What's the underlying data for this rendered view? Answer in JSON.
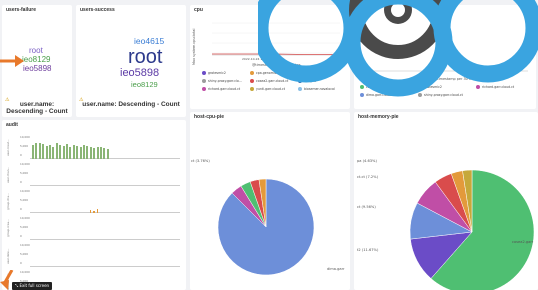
{
  "panels": {
    "users_failure": {
      "title": "users-failure",
      "words": [
        "root",
        "ieo8129",
        "ieo5898"
      ],
      "sort_label": "user.name: Descending - Count"
    },
    "users_success": {
      "title": "users-success",
      "words": [
        "ieo4615",
        "root",
        "ieo5898",
        "ieo8129"
      ],
      "sort_label": "user.name: Descending - Count"
    },
    "cpu": {
      "title": "cpu",
      "ylabel": "Max system.cpu.total",
      "xlabel": "@timestamp per 30 minutes",
      "xtick": "2022-10-24 18:00",
      "legend": [
        "grotesmic2",
        "cpa.genomic.garr.cloud.ct",
        "dima.garr.cloud.ct",
        "shiny-proxy.garr.clo...",
        "cosea2.garr.cloud.ct",
        "epagou",
        "richard.garr.cloud.ct",
        "yunti.garr.cloud.ct",
        "biosemer.novalocal"
      ],
      "legend_colors": [
        "#6b4cc7",
        "#e39a3b",
        "#6d8fd9",
        "#9c9c9c",
        "#d94c4c",
        "#2f6db3",
        "#c04ea6",
        "#c6a83a",
        "#8bc0e6"
      ]
    },
    "memory": {
      "xlabel": "@timestamp per 30 minutes",
      "legend": [
        "cosea2.garr.cloud.ct",
        "protesmic2",
        "richard.garr.cloud.ct",
        "dima.garr.cloud.ct",
        "shiny-proxy.garr.cloud.ct"
      ],
      "legend_colors": [
        "#4fbf72",
        "#6b4cc7",
        "#c04ea6",
        "#6d8fd9",
        "#9c9c9c"
      ]
    },
    "audit": {
      "title": "audit",
      "rows": [
        "user.creat...",
        "user.chan...",
        "group.cha...",
        "group.crea...",
        "user.dele...",
        "user.rename"
      ],
      "ticks": [
        "10,000",
        "5,000",
        "0"
      ]
    },
    "host_cpu_pie": {
      "title": "host-cpu-pie",
      "labels": [
        "ct (3.76%)",
        "dima.garr"
      ]
    },
    "host_memory_pie": {
      "title": "host-memory-pie",
      "labels": [
        "pa (4.63%)",
        "ct.ct (7.2%)",
        "ct (9.56%)",
        "t2 (11.67%)",
        "cosea2.garr"
      ]
    }
  },
  "chart_data": [
    {
      "type": "pie",
      "title": "host-cpu-pie",
      "labels": [
        "dima.garr.cloud.ct",
        "other",
        "other",
        "other",
        "other"
      ],
      "values": [
        87.5,
        3.76,
        3.4,
        3.0,
        2.34
      ],
      "colors": [
        "#6d8fd9",
        "#c04ea6",
        "#4fbf72",
        "#d94c4c",
        "#e39a3b"
      ]
    },
    {
      "type": "pie",
      "title": "host-memory-pie",
      "labels": [
        "cosea2.garr.cloud.ct",
        "t2",
        "ct",
        "ct.ct",
        "pa",
        "other",
        "other"
      ],
      "values": [
        61.5,
        11.67,
        9.56,
        7.2,
        4.63,
        3.0,
        2.44
      ],
      "colors": [
        "#4fbf72",
        "#6b4cc7",
        "#6d8fd9",
        "#c04ea6",
        "#d94c4c",
        "#e39a3b",
        "#c6a83a"
      ]
    }
  ],
  "overlay": {
    "exit_label": "Exit full screen"
  }
}
